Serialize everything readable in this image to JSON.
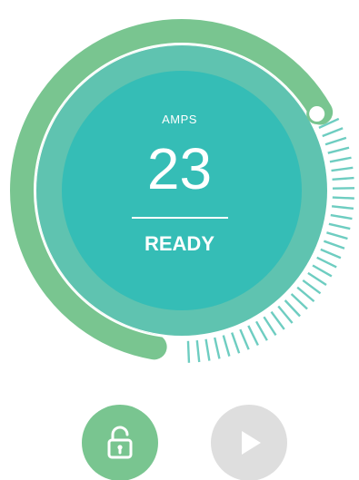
{
  "dial": {
    "label": "AMPS",
    "value": "23",
    "status": "READY",
    "level_fraction": 0.72
  },
  "controls": {
    "lock_icon": "unlock-icon",
    "play_icon": "play-icon",
    "lock_state": "unlocked",
    "play_enabled": false
  },
  "colors": {
    "progress_arc": "#79c590",
    "outer_ring": "#5fc3b0",
    "inner_disc": "#35bdb6",
    "ticks": "#6ecdc1",
    "knob_border": "#79c590",
    "lock_button": "#79c590",
    "play_button_disabled": "#dedede"
  }
}
